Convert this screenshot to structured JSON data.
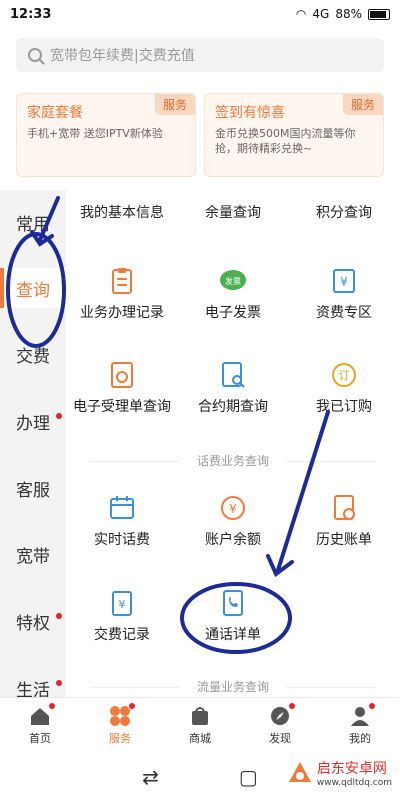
{
  "status": {
    "time": "12:33",
    "net": "4G",
    "battery": "88%"
  },
  "search": {
    "placeholder": "宽带包年续费|交费充值"
  },
  "promos": [
    {
      "title": "家庭套餐",
      "desc": "手机+宽带 送您IPTV新体验",
      "tag": "服务"
    },
    {
      "title": "签到有惊喜",
      "desc": "金币兑换500M国内流量等你抢，期待精彩兑换~",
      "tag": "服务"
    }
  ],
  "sidebar": [
    {
      "label": "常用"
    },
    {
      "label": "查询"
    },
    {
      "label": "交费"
    },
    {
      "label": "办理"
    },
    {
      "label": "客服"
    },
    {
      "label": "宽带"
    },
    {
      "label": "特权"
    },
    {
      "label": "生活"
    }
  ],
  "grid": {
    "row0": [
      "我的基本信息",
      "余量查询",
      "积分查询"
    ],
    "row1": [
      "业务办理记录",
      "电子发票",
      "资费专区"
    ],
    "row2": [
      "电子受理单查询",
      "合约期查询",
      "我已订购"
    ],
    "section1": "话费业务查询",
    "row3": [
      "实时话费",
      "账户余额",
      "历史账单"
    ],
    "row4": [
      "交费记录",
      "通话详单"
    ],
    "section2": "流量业务查询"
  },
  "bottom_nav": [
    {
      "label": "首页",
      "icon": "home-icon"
    },
    {
      "label": "服务",
      "icon": "service-icon"
    },
    {
      "label": "商城",
      "icon": "shop-icon"
    },
    {
      "label": "发现",
      "icon": "discover-icon"
    },
    {
      "label": "我的",
      "icon": "profile-icon"
    }
  ],
  "watermark": {
    "name": "启东安卓网",
    "url": "www.qdltdq.com"
  },
  "colors": {
    "accent": "#f07a3a",
    "annotation": "#1d2b9a",
    "badge": "#e8222a"
  }
}
